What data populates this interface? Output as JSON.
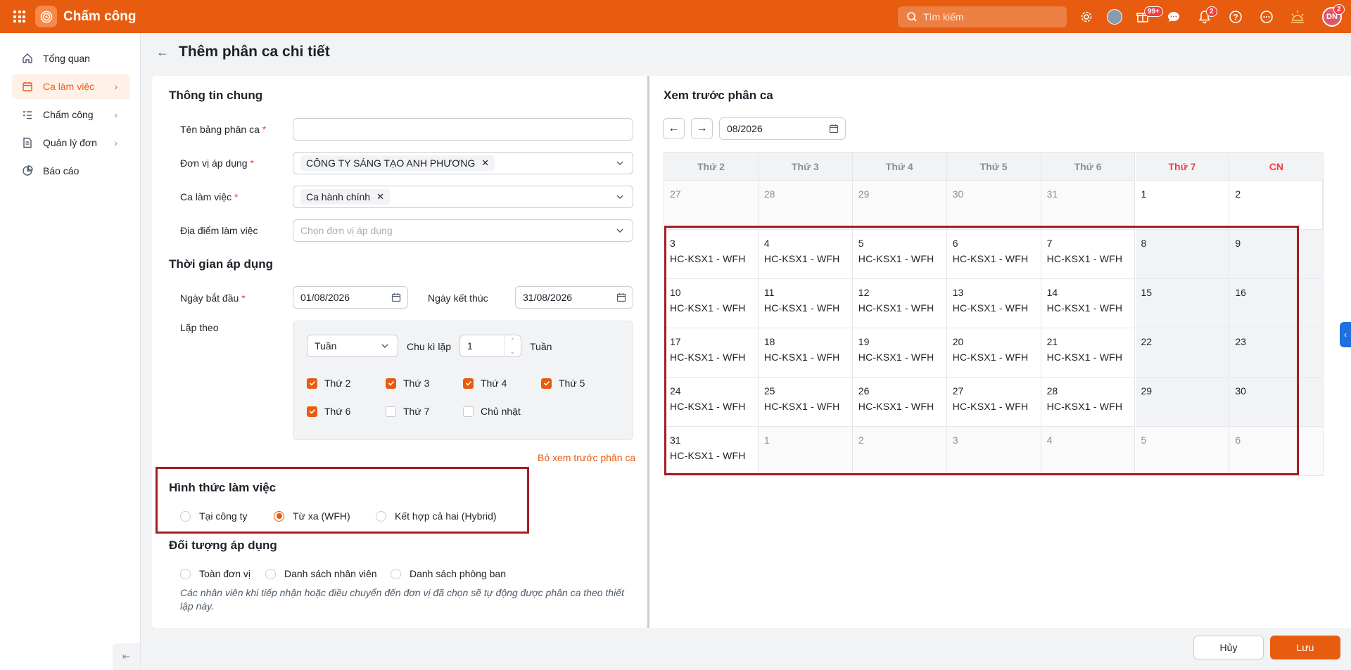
{
  "app": {
    "title": "Chấm công",
    "search_placeholder": "Tìm kiếm",
    "notif_badge_1": "99+",
    "notif_badge_2": "2",
    "avatar_initials": "DN",
    "avatar_badge": "2"
  },
  "sidebar": {
    "items": [
      {
        "label": "Tổng quan",
        "icon": "home-icon"
      },
      {
        "label": "Ca làm việc",
        "icon": "calendar-icon"
      },
      {
        "label": "Chấm công",
        "icon": "checklist-icon"
      },
      {
        "label": "Quản lý đơn",
        "icon": "document-icon"
      },
      {
        "label": "Báo cáo",
        "icon": "pie-chart-icon"
      }
    ],
    "collapse": "⇤"
  },
  "page": {
    "title": "Thêm phân ca chi tiết"
  },
  "general": {
    "title": "Thông tin chung",
    "name_label": "Tên bảng phân ca",
    "unit_label": "Đơn vị áp dụng",
    "unit_value": "CÔNG TY SÁNG TẠO ANH PHƯƠNG",
    "shift_label": "Ca làm việc",
    "shift_value": "Ca hành chính",
    "location_label": "Địa điểm làm việc",
    "location_placeholder": "Chọn đơn vị áp dụng"
  },
  "time": {
    "title": "Thời gian áp dụng",
    "start_label": "Ngày bắt đầu",
    "start_value": "01/08/2026",
    "end_label": "Ngày kết thúc",
    "end_value": "31/08/2026",
    "repeat_label": "Lặp theo",
    "repeat_unit": "Tuần",
    "cycle_label": "Chu kì lặp",
    "cycle_value": "1",
    "cycle_unit": "Tuần",
    "days": [
      {
        "label": "Thứ 2",
        "checked": true
      },
      {
        "label": "Thứ 3",
        "checked": true
      },
      {
        "label": "Thứ 4",
        "checked": true
      },
      {
        "label": "Thứ 5",
        "checked": true
      },
      {
        "label": "Thứ 6",
        "checked": true
      },
      {
        "label": "Thứ 7",
        "checked": false
      },
      {
        "label": "Chủ nhật",
        "checked": false
      }
    ],
    "hide_preview": "Bỏ xem trước phân ca"
  },
  "work_mode": {
    "title": "Hình thức làm việc",
    "options": [
      "Tại công ty",
      "Từ xa (WFH)",
      "Kết hợp cả hai (Hybrid)"
    ],
    "selected": 1
  },
  "target": {
    "title": "Đối tượng áp dụng",
    "options": [
      "Toàn đơn vị",
      "Danh sách nhân viên",
      "Danh sách phòng ban"
    ],
    "note": "Các nhân viên khi tiếp nhận hoặc điều chuyển đến đơn vị đã chọn sẽ tự động được phân ca theo thiết lập này."
  },
  "preview": {
    "title": "Xem trước phân ca",
    "month": "08/2026",
    "weekdays": [
      "Thứ 2",
      "Thứ 3",
      "Thứ 4",
      "Thứ 5",
      "Thứ 6",
      "Thứ 7",
      "CN"
    ],
    "shift_text": "HC-KSX1 - WFH",
    "weeks": [
      [
        {
          "d": "27",
          "o": true
        },
        {
          "d": "28",
          "o": true
        },
        {
          "d": "29",
          "o": true
        },
        {
          "d": "30",
          "o": true
        },
        {
          "d": "31",
          "o": true
        },
        {
          "d": "1",
          "o": false
        },
        {
          "d": "2",
          "o": false
        }
      ],
      [
        {
          "d": "3",
          "s": true
        },
        {
          "d": "4",
          "s": true
        },
        {
          "d": "5",
          "s": true
        },
        {
          "d": "6",
          "s": true
        },
        {
          "d": "7",
          "s": true
        },
        {
          "d": "8"
        },
        {
          "d": "9"
        }
      ],
      [
        {
          "d": "10",
          "s": true
        },
        {
          "d": "11",
          "s": true
        },
        {
          "d": "12",
          "s": true
        },
        {
          "d": "13",
          "s": true
        },
        {
          "d": "14",
          "s": true
        },
        {
          "d": "15"
        },
        {
          "d": "16"
        }
      ],
      [
        {
          "d": "17",
          "s": true
        },
        {
          "d": "18",
          "s": true
        },
        {
          "d": "19",
          "s": true
        },
        {
          "d": "20",
          "s": true
        },
        {
          "d": "21",
          "s": true
        },
        {
          "d": "22"
        },
        {
          "d": "23"
        }
      ],
      [
        {
          "d": "24",
          "s": true
        },
        {
          "d": "25",
          "s": true
        },
        {
          "d": "26",
          "s": true
        },
        {
          "d": "27",
          "s": true
        },
        {
          "d": "28",
          "s": true
        },
        {
          "d": "29"
        },
        {
          "d": "30"
        }
      ],
      [
        {
          "d": "31",
          "s": true
        },
        {
          "d": "1",
          "o": true
        },
        {
          "d": "2",
          "o": true
        },
        {
          "d": "3",
          "o": true
        },
        {
          "d": "4",
          "o": true
        },
        {
          "d": "5",
          "o": true
        },
        {
          "d": "6",
          "o": true
        }
      ]
    ]
  },
  "actions": {
    "cancel": "Hủy",
    "save": "Lưu"
  },
  "colors": {
    "brand": "#e85c0f",
    "highlight_box": "#a51d24"
  }
}
